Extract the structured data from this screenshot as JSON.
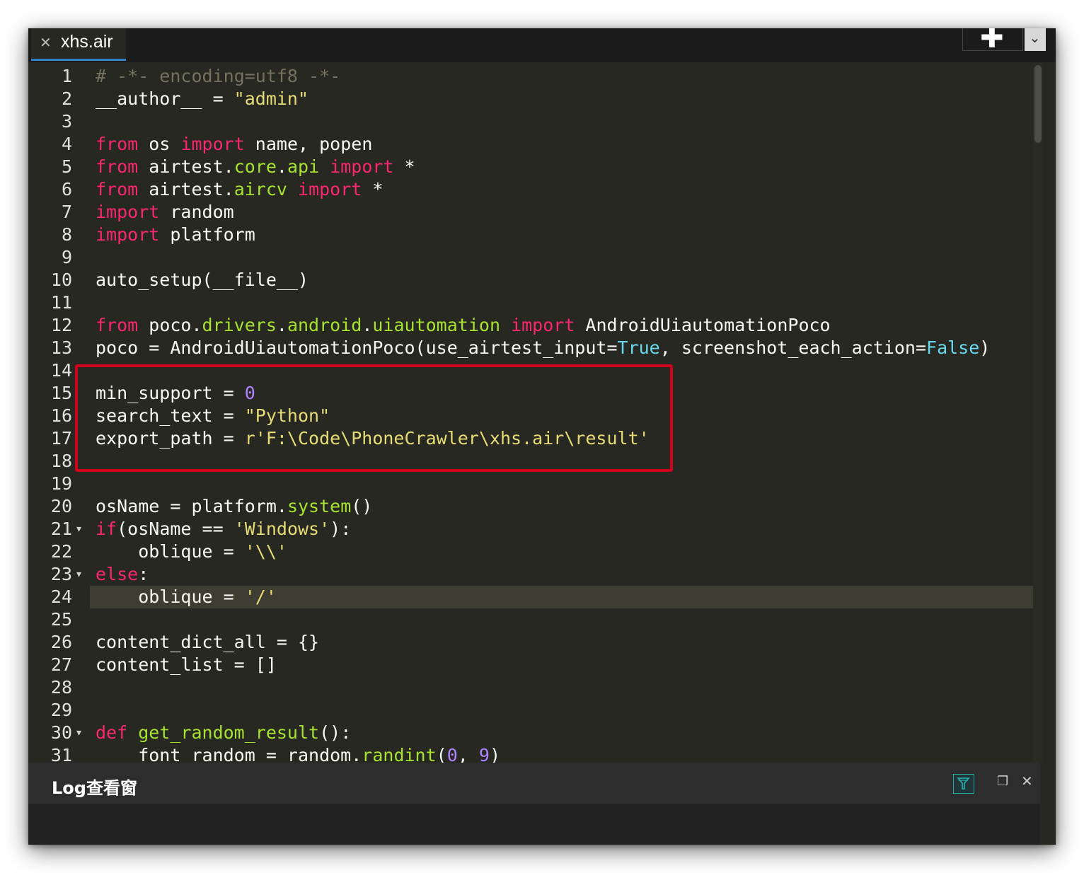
{
  "tab": {
    "label": "xhs.air",
    "close_glyph": "✕"
  },
  "toolbar": {
    "add_glyph": "✚",
    "dropdown_glyph": "⌄"
  },
  "log_panel": {
    "title": "Log查看窗",
    "restore_glyph": "❐",
    "close_glyph": "✕"
  },
  "theme": {
    "accent": "#2d82c8",
    "highlight_border": "#d0021b",
    "filter_accent": "#2aa5a5"
  },
  "editor": {
    "lines": [
      {
        "num": "1",
        "tokens": [
          {
            "t": "comment",
            "v": "# -*- encoding=utf8 -*-"
          }
        ]
      },
      {
        "num": "2",
        "tokens": [
          {
            "t": "default",
            "v": "__author__ = "
          },
          {
            "t": "string",
            "v": "\"admin\""
          }
        ]
      },
      {
        "num": "3",
        "tokens": []
      },
      {
        "num": "4",
        "tokens": [
          {
            "t": "keyword",
            "v": "from"
          },
          {
            "t": "default",
            "v": " os "
          },
          {
            "t": "keyword",
            "v": "import"
          },
          {
            "t": "default",
            "v": " name, popen"
          }
        ]
      },
      {
        "num": "5",
        "tokens": [
          {
            "t": "keyword",
            "v": "from"
          },
          {
            "t": "default",
            "v": " airtest."
          },
          {
            "t": "attr",
            "v": "core"
          },
          {
            "t": "default",
            "v": "."
          },
          {
            "t": "attr",
            "v": "api"
          },
          {
            "t": "default",
            "v": " "
          },
          {
            "t": "keyword",
            "v": "import"
          },
          {
            "t": "default",
            "v": " *"
          }
        ]
      },
      {
        "num": "6",
        "tokens": [
          {
            "t": "keyword",
            "v": "from"
          },
          {
            "t": "default",
            "v": " airtest."
          },
          {
            "t": "attr",
            "v": "aircv"
          },
          {
            "t": "default",
            "v": " "
          },
          {
            "t": "keyword",
            "v": "import"
          },
          {
            "t": "default",
            "v": " *"
          }
        ]
      },
      {
        "num": "7",
        "tokens": [
          {
            "t": "keyword",
            "v": "import"
          },
          {
            "t": "default",
            "v": " random"
          }
        ]
      },
      {
        "num": "8",
        "tokens": [
          {
            "t": "keyword",
            "v": "import"
          },
          {
            "t": "default",
            "v": " platform"
          }
        ]
      },
      {
        "num": "9",
        "tokens": []
      },
      {
        "num": "10",
        "tokens": [
          {
            "t": "default",
            "v": "auto_setup(__file__)"
          }
        ]
      },
      {
        "num": "11",
        "tokens": []
      },
      {
        "num": "12",
        "tokens": [
          {
            "t": "keyword",
            "v": "from"
          },
          {
            "t": "default",
            "v": " poco."
          },
          {
            "t": "attr",
            "v": "drivers"
          },
          {
            "t": "default",
            "v": "."
          },
          {
            "t": "attr",
            "v": "android"
          },
          {
            "t": "default",
            "v": "."
          },
          {
            "t": "attr",
            "v": "uiautomation"
          },
          {
            "t": "default",
            "v": " "
          },
          {
            "t": "keyword",
            "v": "import"
          },
          {
            "t": "default",
            "v": " AndroidUiautomationPoco"
          }
        ]
      },
      {
        "num": "13",
        "tokens": [
          {
            "t": "default",
            "v": "poco = AndroidUiautomationPoco(use_airtest_input="
          },
          {
            "t": "const",
            "v": "True"
          },
          {
            "t": "default",
            "v": ", screenshot_each_action="
          },
          {
            "t": "const",
            "v": "False"
          },
          {
            "t": "default",
            "v": ")"
          }
        ]
      },
      {
        "num": "14",
        "tokens": []
      },
      {
        "num": "15",
        "tokens": [
          {
            "t": "default",
            "v": "min_support = "
          },
          {
            "t": "number",
            "v": "0"
          }
        ]
      },
      {
        "num": "16",
        "tokens": [
          {
            "t": "default",
            "v": "search_text = "
          },
          {
            "t": "string",
            "v": "\"Python\""
          }
        ]
      },
      {
        "num": "17",
        "tokens": [
          {
            "t": "default",
            "v": "export_path = "
          },
          {
            "t": "string",
            "v": "r'F:\\Code\\PhoneCrawler\\xhs.air\\result'"
          }
        ]
      },
      {
        "num": "18",
        "tokens": []
      },
      {
        "num": "19",
        "tokens": []
      },
      {
        "num": "20",
        "tokens": [
          {
            "t": "default",
            "v": "osName = platform."
          },
          {
            "t": "attr",
            "v": "system"
          },
          {
            "t": "default",
            "v": "()"
          }
        ]
      },
      {
        "num": "21",
        "fold": "▾",
        "tokens": [
          {
            "t": "keyword",
            "v": "if"
          },
          {
            "t": "default",
            "v": "(osName == "
          },
          {
            "t": "string",
            "v": "'Windows'"
          },
          {
            "t": "default",
            "v": "):"
          }
        ]
      },
      {
        "num": "22",
        "tokens": [
          {
            "t": "default",
            "v": "    oblique = "
          },
          {
            "t": "string",
            "v": "'\\\\'"
          }
        ]
      },
      {
        "num": "23",
        "fold": "▾",
        "tokens": [
          {
            "t": "keyword",
            "v": "else"
          },
          {
            "t": "default",
            "v": ":"
          }
        ]
      },
      {
        "num": "24",
        "active": true,
        "tokens": [
          {
            "t": "default",
            "v": "    oblique = "
          },
          {
            "t": "string",
            "v": "'/'"
          }
        ]
      },
      {
        "num": "25",
        "tokens": []
      },
      {
        "num": "26",
        "tokens": [
          {
            "t": "default",
            "v": "content_dict_all = {}"
          }
        ]
      },
      {
        "num": "27",
        "tokens": [
          {
            "t": "default",
            "v": "content_list = []"
          }
        ]
      },
      {
        "num": "28",
        "tokens": []
      },
      {
        "num": "29",
        "tokens": []
      },
      {
        "num": "30",
        "fold": "▾",
        "tokens": [
          {
            "t": "keyword",
            "v": "def"
          },
          {
            "t": "default",
            "v": " "
          },
          {
            "t": "attr",
            "v": "get_random_result"
          },
          {
            "t": "default",
            "v": "():"
          }
        ]
      },
      {
        "num": "31",
        "tokens": [
          {
            "t": "default",
            "v": "    font_random = random."
          },
          {
            "t": "attr",
            "v": "randint"
          },
          {
            "t": "default",
            "v": "("
          },
          {
            "t": "number",
            "v": "0"
          },
          {
            "t": "default",
            "v": ", "
          },
          {
            "t": "number",
            "v": "9"
          },
          {
            "t": "default",
            "v": ")"
          }
        ]
      }
    ]
  }
}
